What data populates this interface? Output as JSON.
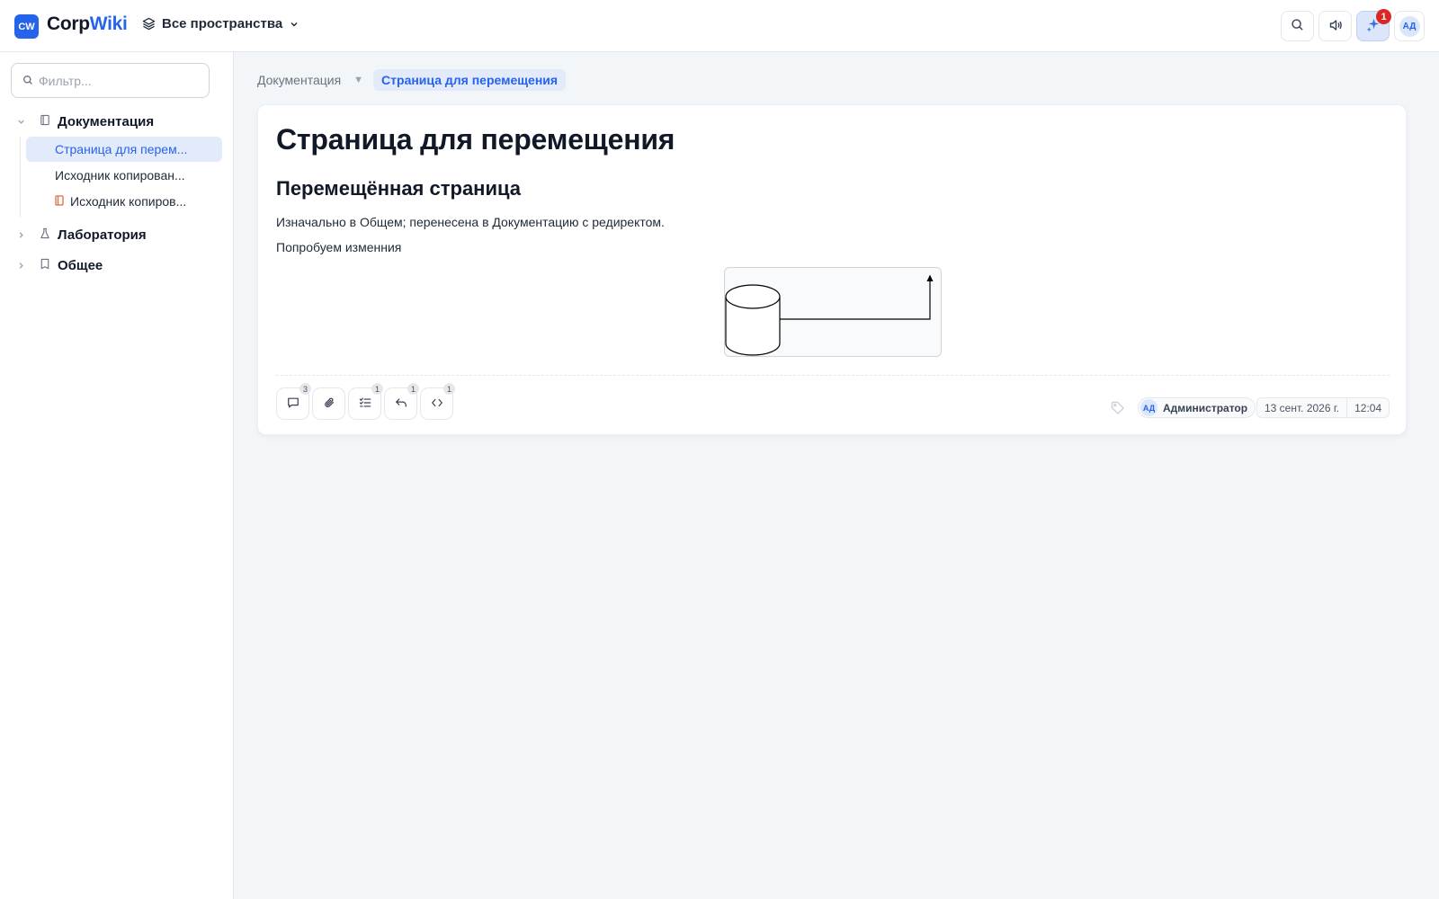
{
  "app": {
    "logo_badge": "CW",
    "name_part1": "Corp",
    "name_part2": "Wiki"
  },
  "header": {
    "spaces_label": "Все пространства",
    "notifications_count": "1",
    "user_initials": "АД"
  },
  "sidebar": {
    "filter_placeholder": "Фильтр...",
    "spaces": [
      {
        "label": "Документация",
        "expanded": true
      },
      {
        "label": "Лаборатория",
        "expanded": false
      },
      {
        "label": "Общее",
        "expanded": false
      }
    ],
    "pages": [
      {
        "label": "Страница для перем...",
        "selected": true
      },
      {
        "label": "Исходник копирован..."
      },
      {
        "label": "Исходник копиров..."
      }
    ]
  },
  "breadcrumb": {
    "space": "Документация",
    "current": "Страница для перемещения"
  },
  "page": {
    "title": "Страница для перемещения",
    "heading": "Перемещённая страница",
    "paragraph1": "Изначально в Общем; перенесена в Документацию с редиректом.",
    "paragraph2": "Попробуем изменния"
  },
  "footer": {
    "comments_count": "3",
    "tasks_count": "1",
    "history_count": "1",
    "embeds_count": "1",
    "author_initials": "АД",
    "author_name": "Администратор",
    "date": "13 сент. 2026 г.",
    "time": "12:04"
  },
  "colors": {
    "accent": "#2563eb",
    "badge": "#dc2626",
    "selected_bg": "#e3ebfb"
  }
}
